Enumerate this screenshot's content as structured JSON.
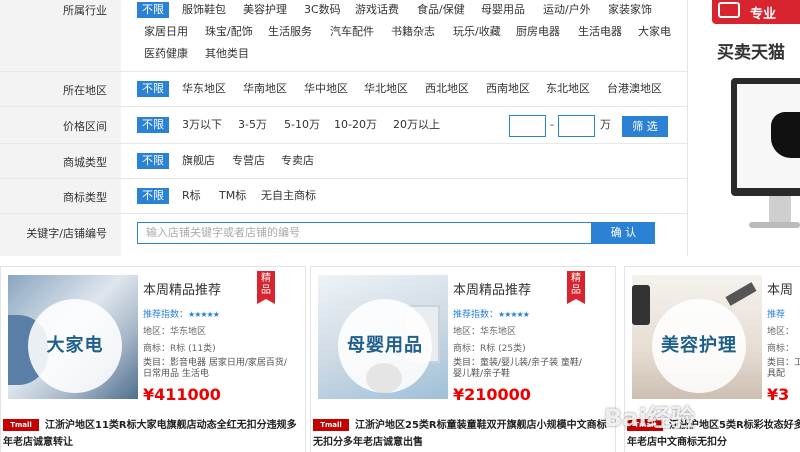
{
  "filters": {
    "industry": {
      "label": "所属行业",
      "selected": "不限",
      "options": [
        "服饰鞋包",
        "美容护理",
        "3C数码",
        "游戏话费",
        "食品/保健",
        "母婴用品",
        "运动/户外",
        "家装家饰",
        "家居日用",
        "珠宝/配饰",
        "生活服务",
        "汽车配件",
        "书籍杂志",
        "玩乐/收藏",
        "厨房电器",
        "生活电器",
        "大家电",
        "医药健康",
        "其他类目"
      ]
    },
    "region": {
      "label": "所在地区",
      "selected": "不限",
      "options": [
        "华东地区",
        "华南地区",
        "华中地区",
        "华北地区",
        "西北地区",
        "西南地区",
        "东北地区",
        "台港澳地区"
      ]
    },
    "price": {
      "label": "价格区间",
      "selected": "不限",
      "options": [
        "3万以下",
        "3-5万",
        "5-10万",
        "10-20万",
        "20万以上"
      ],
      "min_value": "",
      "max_value": "",
      "dash": "-",
      "unit": "万",
      "filter_button": "筛 选"
    },
    "mall_type": {
      "label": "商城类型",
      "selected": "不限",
      "options": [
        "旗舰店",
        "专营店",
        "专卖店"
      ]
    },
    "brand_type": {
      "label": "商标类型",
      "selected": "不限",
      "options": [
        "R标",
        "TM标",
        "无自主商标"
      ]
    },
    "keyword": {
      "label": "关键字/店铺编号",
      "placeholder": "输入店铺关键字或者店铺的编号",
      "confirm_button": "确 认"
    }
  },
  "right_panel": {
    "top_label": "专业",
    "promo_text": "买卖天猫"
  },
  "cards": [
    {
      "image_label": "大家电",
      "title": "本周精品推荐",
      "badge": "精品",
      "rating_label": "推荐指数：",
      "stars": "★★★★★",
      "region": "地区：华东地区",
      "brand": "商标：R标 (11类)",
      "category": "类目：影音电器    居家日用/家居百货/日常用品    生活电",
      "price": "¥411000",
      "tmall_tag": "Tmall 0:0",
      "desc": "江浙沪地区11类R标大家电旗舰店动态全红无扣分违规多年老店诚意转让"
    },
    {
      "image_label": "母婴用品",
      "title": "本周精品推荐",
      "badge": "精品",
      "rating_label": "推荐指数：",
      "stars": "★★★★★",
      "region": "地区：华东地区",
      "brand": "商标：R标 (25类)",
      "category": "类目：童装/婴儿装/亲子装    童鞋/婴儿鞋/亲子鞋",
      "price": "¥210000",
      "tmall_tag": "Tmall 0:0",
      "desc": "江浙沪地区25类R标童装童鞋双开旗舰店小规模中文商标无扣分多年老店诚意出售"
    },
    {
      "image_label": "美容护理",
      "title": "本周",
      "badge": "",
      "rating_label": "推荐",
      "stars": "",
      "region": "地区：",
      "brand": "商标：",
      "category": "类目：工具配",
      "price": "¥3",
      "tmall_tag": "Tmall 0:0",
      "desc": "江浙沪地区5类R标彩妆态好多年老店中文商标无扣分"
    }
  ],
  "watermark": "Bai经验"
}
